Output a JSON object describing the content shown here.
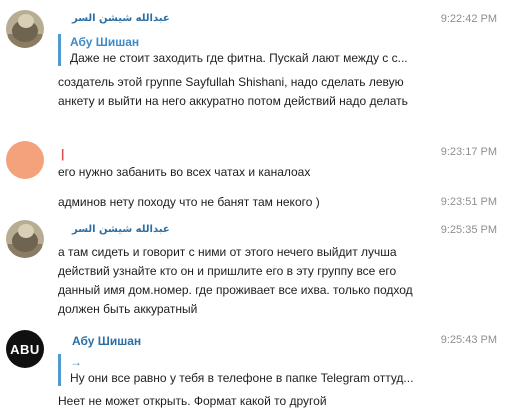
{
  "messages": [
    {
      "sender": "عبدالله شيشن السر",
      "time": "9:22:42 PM",
      "reply_name": "Абу Шишан",
      "reply_text": "Даже не стоит заходить где фитна. Пускай лают между с с...",
      "text": "создатель этой группе Sayfullah Shishani, надо сделать левую анкету и выйти на него аккуратно потом действий надо делать"
    },
    {
      "reply_name": "",
      "reply_mark": "|",
      "time": "9:23:17 PM",
      "text": "его нужно забанить во всех чатах и каналоах"
    },
    {
      "time": "9:23:51 PM",
      "text": "админов нету походу что не банят там некого )"
    },
    {
      "sender": "عبدالله شيشن السر",
      "time": "9:25:35 PM",
      "text": "а там сидеть и говорит с ними от этого нечего выйдит лучша действий узнайте кто он и пришлите его в эту группу все его данный имя дом.номер.  где проживает все ихва. только подход должен быть аккуратный"
    },
    {
      "sender": "Абу Шишан",
      "avatar_logo": "ABU",
      "time": "9:25:43 PM",
      "reply_mark": "→",
      "reply_text": "Ну они все равно у тебя в телефоне в папке Telegram оттуд...",
      "text": "Неет не может открыть.  Формат какой то другой"
    }
  ],
  "colors": {
    "sender": "#2d6fa4",
    "reply_bar": "#4f9ad1",
    "time": "#8f8f8f"
  }
}
